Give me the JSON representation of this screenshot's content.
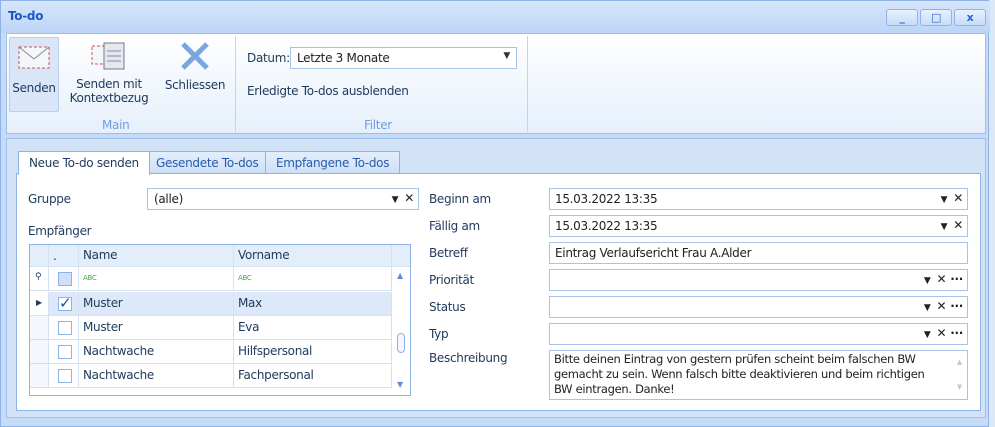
{
  "window": {
    "title": "To-do",
    "minimize": "_",
    "maximize": "□",
    "close": "x"
  },
  "ribbon": {
    "main_group": {
      "label": "Main",
      "buttons": [
        {
          "label": "Senden"
        },
        {
          "label": "Senden mit",
          "label2": "Kontextbezug"
        },
        {
          "label": "Schliessen"
        }
      ]
    },
    "filter_group": {
      "label": "Filter",
      "datum_label": "Datum:",
      "datum_value": "Letzte 3 Monate",
      "hide_done": "Erledigte To-dos ausblenden"
    }
  },
  "tabs": [
    {
      "label": "Neue To-do senden",
      "active": true
    },
    {
      "label": "Gesendete To-dos"
    },
    {
      "label": "Empfangene To-dos"
    }
  ],
  "form": {
    "gruppe_label": "Gruppe",
    "gruppe_value": "(alle)",
    "empfaenger_label": "Empfänger",
    "grid": {
      "columns": [
        ".",
        "Name",
        "Vorname"
      ],
      "filter_icon": "ABC",
      "rows": [
        {
          "checked": true,
          "name": "Muster",
          "vorname": "Max"
        },
        {
          "checked": false,
          "name": "Muster",
          "vorname": "Eva"
        },
        {
          "checked": false,
          "name": "Nachtwache",
          "vorname": "Hilfspersonal"
        },
        {
          "checked": false,
          "name": "Nachtwache",
          "vorname": "Fachpersonal"
        }
      ]
    },
    "beginn_label": "Beginn am",
    "beginn_value": "15.03.2022 13:35",
    "faellig_label": "Fällig am",
    "faellig_value": "15.03.2022 13:35",
    "betreff_label": "Betreff",
    "betreff_value": "Eintrag Verlaufsericht Frau A.Alder",
    "prioritaet_label": "Priorität",
    "prioritaet_value": "",
    "status_label": "Status",
    "status_value": "",
    "typ_label": "Typ",
    "typ_value": "",
    "beschreibung_label": "Beschreibung",
    "beschreibung_value": "Bitte deinen Eintrag von gestern prüfen scheint beim falschen BW gemacht zu sein. Wenn falsch bitte deaktivieren und beim richtigen BW eintragen. Danke!"
  }
}
